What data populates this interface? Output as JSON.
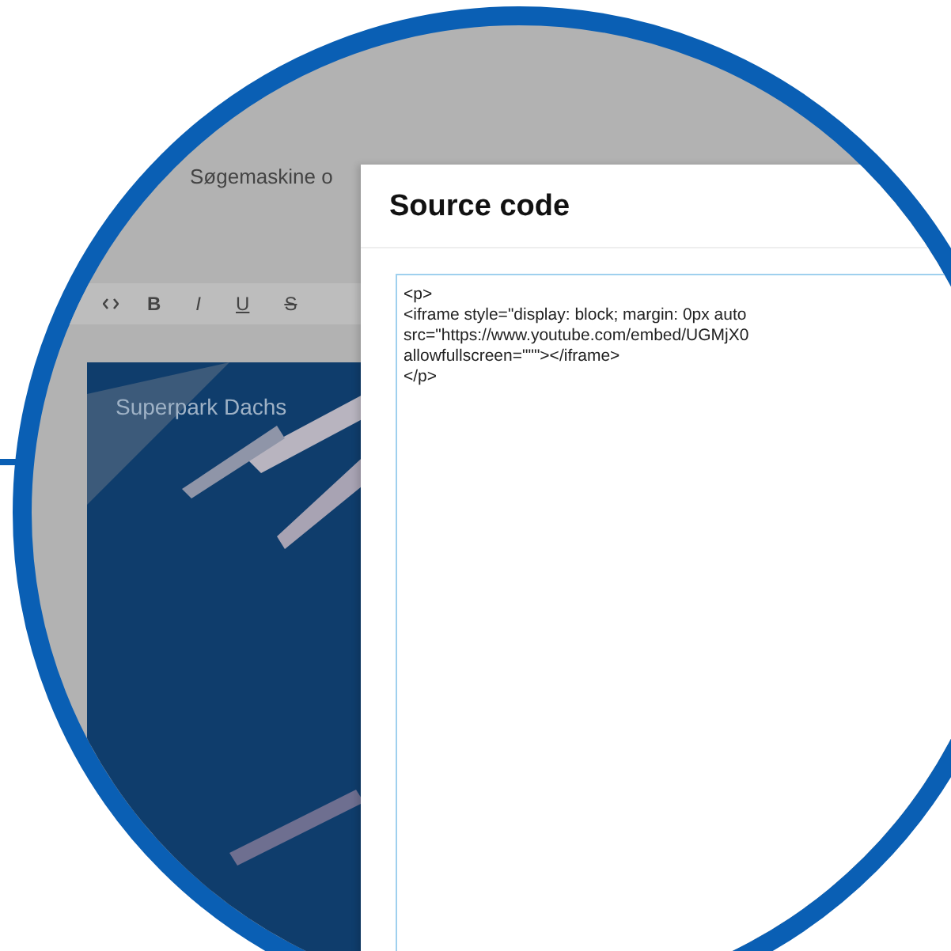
{
  "editor": {
    "title": "Søgemaskine o",
    "toolbar": [
      {
        "kind": "bold",
        "label": "B"
      },
      {
        "kind": "italic",
        "label": "I"
      },
      {
        "kind": "underline",
        "label": "U"
      },
      {
        "kind": "strike",
        "label": "S"
      }
    ],
    "video": {
      "caption": "Superpark Dachs"
    }
  },
  "dialog": {
    "title": "Source code",
    "code_lines": [
      "<p>",
      "<iframe style=\"display: block; margin: 0px auto",
      "src=\"https://www.youtube.com/embed/UGMjX0",
      "allowfullscreen=\"\"\"></iframe>",
      "</p>"
    ]
  }
}
